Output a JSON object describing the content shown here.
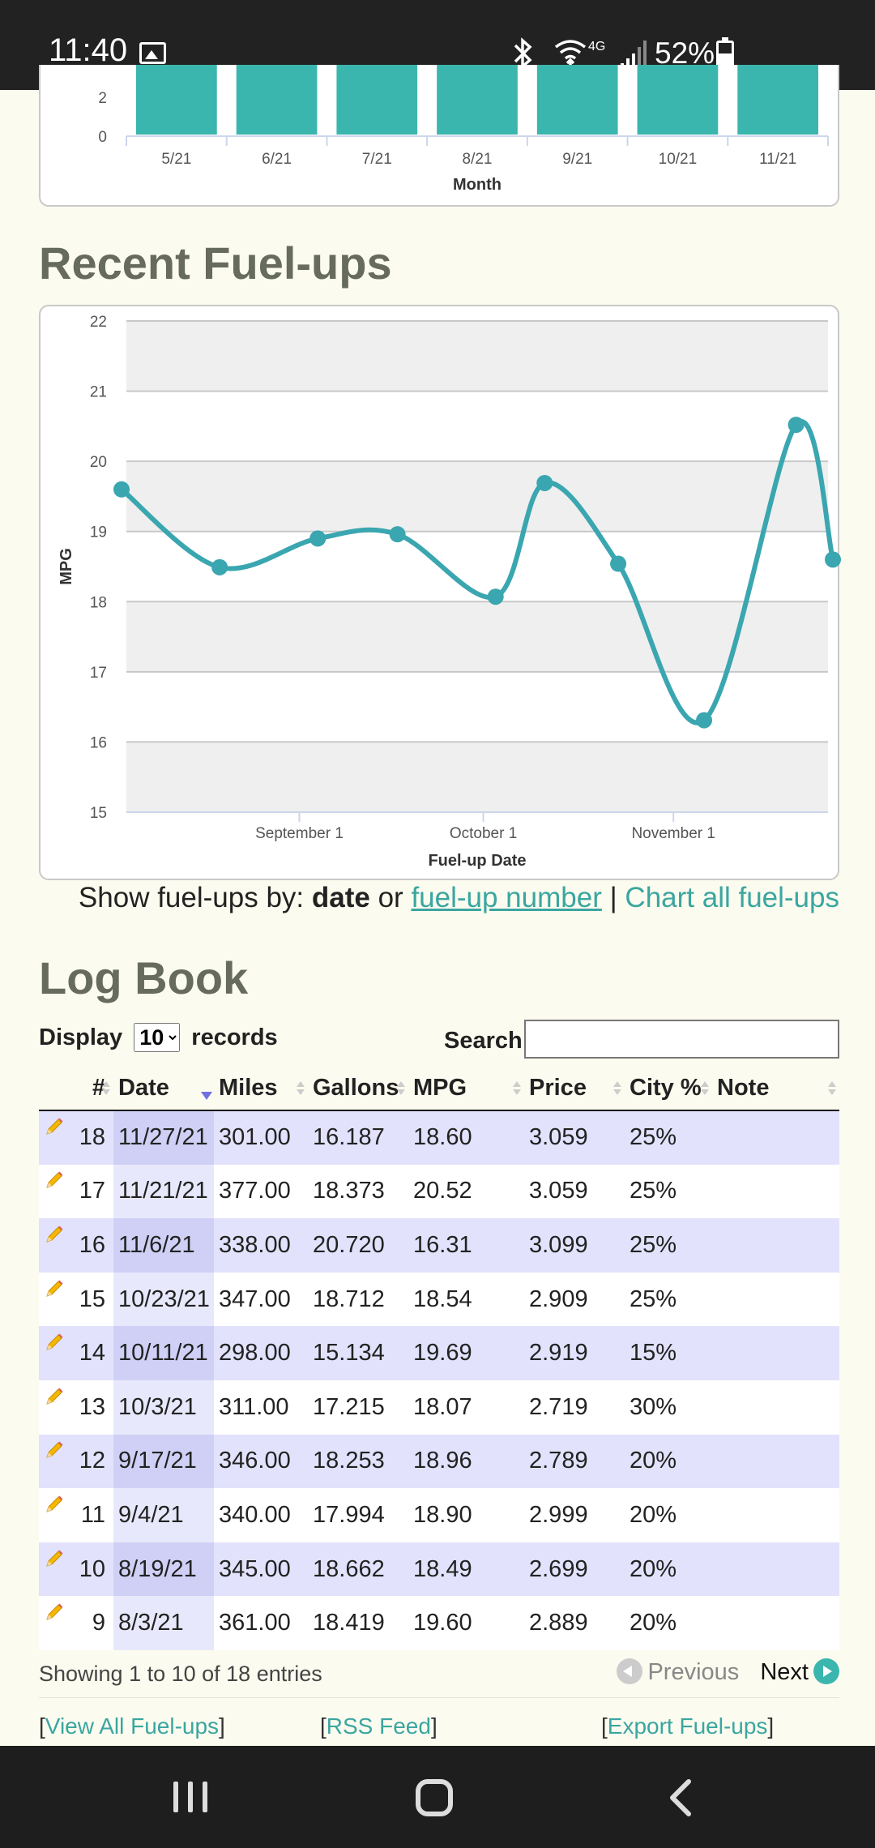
{
  "status_bar": {
    "time": "11:40",
    "battery": "52%",
    "network_label": "4G",
    "icons": [
      "image-icon",
      "bluetooth-icon",
      "wifi-icon",
      "signal-icon",
      "battery-icon"
    ]
  },
  "monthly_chart": {
    "chart_data": {
      "type": "bar",
      "categories": [
        "5/21",
        "6/21",
        "7/21",
        "8/21",
        "9/21",
        "10/21",
        "11/21"
      ],
      "visible_yticks": [
        0,
        2
      ],
      "xlabel": "Month",
      "bar_color": "#3ab6ae",
      "note": "only bottom portion of bars visible (scrolled)"
    }
  },
  "recent_fuelups": {
    "title": "Recent Fuel-ups",
    "chart_data": {
      "type": "line",
      "x": [
        "2021-08-03",
        "2021-08-19",
        "2021-09-04",
        "2021-09-17",
        "2021-10-03",
        "2021-10-11",
        "2021-10-23",
        "2021-11-06",
        "2021-11-21",
        "2021-11-27"
      ],
      "values": [
        19.6,
        18.49,
        18.9,
        18.96,
        18.07,
        19.69,
        18.54,
        16.31,
        20.52,
        18.6
      ],
      "ylabel": "MPG",
      "xlabel": "Fuel-up Date",
      "ylim": [
        15,
        22
      ],
      "yticks": [
        15,
        16,
        17,
        18,
        19,
        20,
        21,
        22
      ],
      "xticks": [
        "September 1",
        "October 1",
        "November 1"
      ],
      "xtick_dates": [
        "2021-09-01",
        "2021-10-01",
        "2021-11-01"
      ],
      "xlim": [
        "2021-08-03",
        "2021-11-27"
      ],
      "line_color": "#3aa6b0",
      "grid": true
    }
  },
  "show_by": {
    "prefix": "Show fuel-ups by:",
    "current": "date",
    "or": "or",
    "alt_link": "fuel-up number",
    "separator": "|",
    "chart_all": "Chart all fuel-ups"
  },
  "log_book": {
    "title": "Log Book",
    "display_label": "Display",
    "records_label": "records",
    "page_size": "10",
    "search_label": "Search:",
    "columns": [
      "#",
      "Date",
      "Miles",
      "Gallons",
      "MPG",
      "Price",
      "City %",
      "Note"
    ],
    "rows": [
      [
        "18",
        "11/27/21",
        "301.00",
        "16.187",
        "18.60",
        "3.059",
        "25%",
        ""
      ],
      [
        "17",
        "11/21/21",
        "377.00",
        "18.373",
        "20.52",
        "3.059",
        "25%",
        ""
      ],
      [
        "16",
        "11/6/21",
        "338.00",
        "20.720",
        "16.31",
        "3.099",
        "25%",
        ""
      ],
      [
        "15",
        "10/23/21",
        "347.00",
        "18.712",
        "18.54",
        "2.909",
        "25%",
        ""
      ],
      [
        "14",
        "10/11/21",
        "298.00",
        "15.134",
        "19.69",
        "2.919",
        "15%",
        ""
      ],
      [
        "13",
        "10/3/21",
        "311.00",
        "17.215",
        "18.07",
        "2.719",
        "30%",
        ""
      ],
      [
        "12",
        "9/17/21",
        "346.00",
        "18.253",
        "18.96",
        "2.789",
        "20%",
        ""
      ],
      [
        "11",
        "9/4/21",
        "340.00",
        "17.994",
        "18.90",
        "2.999",
        "20%",
        ""
      ],
      [
        "10",
        "8/19/21",
        "345.00",
        "18.662",
        "18.49",
        "2.699",
        "20%",
        ""
      ],
      [
        "9",
        "8/3/21",
        "361.00",
        "18.419",
        "19.60",
        "2.889",
        "20%",
        ""
      ]
    ],
    "showing": "Showing 1 to 10 of 18 entries",
    "previous": "Previous",
    "next": "Next"
  },
  "footer": {
    "view_all": "View All Fuel-ups",
    "rss": "RSS Feed",
    "export": "Export Fuel-ups"
  },
  "colors": {
    "accent": "#3aa6a0",
    "row_odd": "#e2e2fc",
    "background": "#fcfbef"
  }
}
